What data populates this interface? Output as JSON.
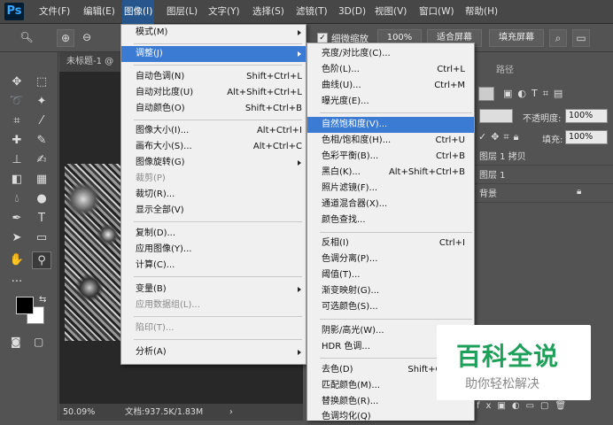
{
  "app": {
    "logo": "Ps"
  },
  "menubar": {
    "items": [
      "文件(F)",
      "编辑(E)",
      "图像(I)",
      "图层(L)",
      "文字(Y)",
      "选择(S)",
      "滤镜(T)",
      "3D(D)",
      "视图(V)",
      "窗口(W)",
      "帮助(H)"
    ]
  },
  "options_bar": {
    "fine_zoom_label": "细微缩放",
    "zoom_value": "100%",
    "fit_screen_label": "适合屏幕",
    "fill_screen_label": "填充屏幕"
  },
  "document": {
    "tab_title": "未标题-1 @",
    "zoom": "50.09%",
    "doc_info": "文档:937.5K/1.83M"
  },
  "image_menu": {
    "items": [
      {
        "label": "模式(M)",
        "shortcut": "",
        "disabled": false,
        "submenu": true
      },
      {
        "label": "调整(J)",
        "shortcut": "",
        "disabled": false,
        "submenu": true,
        "highlighted": true
      },
      {
        "label": "自动色调(N)",
        "shortcut": "Shift+Ctrl+L",
        "disabled": false
      },
      {
        "label": "自动对比度(U)",
        "shortcut": "Alt+Shift+Ctrl+L",
        "disabled": false
      },
      {
        "label": "自动颜色(O)",
        "shortcut": "Shift+Ctrl+B",
        "disabled": false
      },
      {
        "label": "图像大小(I)...",
        "shortcut": "Alt+Ctrl+I",
        "disabled": false
      },
      {
        "label": "画布大小(S)...",
        "shortcut": "Alt+Ctrl+C",
        "disabled": false
      },
      {
        "label": "图像旋转(G)",
        "shortcut": "",
        "disabled": false,
        "submenu": true
      },
      {
        "label": "裁剪(P)",
        "shortcut": "",
        "disabled": true
      },
      {
        "label": "裁切(R)...",
        "shortcut": "",
        "disabled": false
      },
      {
        "label": "显示全部(V)",
        "shortcut": "",
        "disabled": false
      },
      {
        "label": "复制(D)...",
        "shortcut": "",
        "disabled": false
      },
      {
        "label": "应用图像(Y)...",
        "shortcut": "",
        "disabled": false
      },
      {
        "label": "计算(C)...",
        "shortcut": "",
        "disabled": false
      },
      {
        "label": "变量(B)",
        "shortcut": "",
        "disabled": false,
        "submenu": true
      },
      {
        "label": "应用数据组(L)...",
        "shortcut": "",
        "disabled": true
      },
      {
        "label": "陷印(T)...",
        "shortcut": "",
        "disabled": true
      },
      {
        "label": "分析(A)",
        "shortcut": "",
        "disabled": false,
        "submenu": true
      }
    ]
  },
  "adjust_menu": {
    "items": [
      {
        "label": "亮度/对比度(C)...",
        "shortcut": ""
      },
      {
        "label": "色阶(L)...",
        "shortcut": "Ctrl+L"
      },
      {
        "label": "曲线(U)...",
        "shortcut": "Ctrl+M"
      },
      {
        "label": "曝光度(E)...",
        "shortcut": ""
      },
      {
        "label": "自然饱和度(V)...",
        "shortcut": "",
        "highlighted": true
      },
      {
        "label": "色相/饱和度(H)...",
        "shortcut": "Ctrl+U"
      },
      {
        "label": "色彩平衡(B)...",
        "shortcut": "Ctrl+B"
      },
      {
        "label": "黑白(K)...",
        "shortcut": "Alt+Shift+Ctrl+B"
      },
      {
        "label": "照片滤镜(F)...",
        "shortcut": ""
      },
      {
        "label": "通道混合器(X)...",
        "shortcut": ""
      },
      {
        "label": "颜色查找...",
        "shortcut": ""
      },
      {
        "label": "反相(I)",
        "shortcut": "Ctrl+I"
      },
      {
        "label": "色调分离(P)...",
        "shortcut": ""
      },
      {
        "label": "阈值(T)...",
        "shortcut": ""
      },
      {
        "label": "渐变映射(G)...",
        "shortcut": ""
      },
      {
        "label": "可选颜色(S)...",
        "shortcut": ""
      },
      {
        "label": "阴影/高光(W)...",
        "shortcut": ""
      },
      {
        "label": "HDR 色调...",
        "shortcut": ""
      },
      {
        "label": "去色(D)",
        "shortcut": "Shift+Ctrl+U"
      },
      {
        "label": "匹配颜色(M)...",
        "shortcut": ""
      },
      {
        "label": "替换颜色(R)...",
        "shortcut": ""
      },
      {
        "label": "色调均化(Q)",
        "shortcut": ""
      }
    ]
  },
  "right_panel": {
    "tab_paths": "路径",
    "opacity_label": "不透明度:",
    "opacity_value": "100%",
    "fill_label": "填充:",
    "fill_value": "100%",
    "layers": [
      "图层 1 拷贝",
      "图层 1",
      "背景"
    ]
  },
  "watermark": {
    "title": "百科全说",
    "subtitle": "助你轻松解决"
  },
  "colors": {
    "menu_highlight": "#3b7bd4",
    "menubar_active": "#27568d",
    "watermark_green": "#1fa05a"
  }
}
